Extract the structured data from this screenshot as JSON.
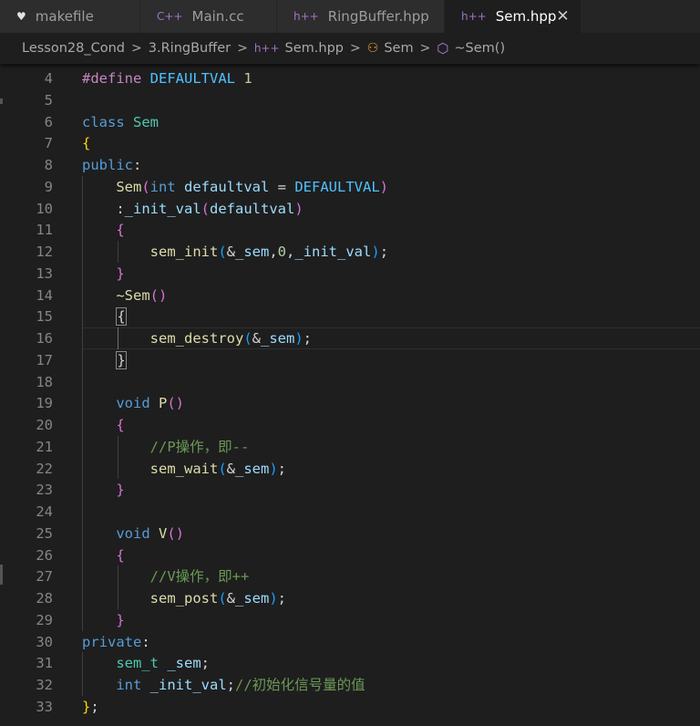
{
  "tabs": [
    {
      "label": "makefile",
      "icon": "makefile-icon",
      "active": false
    },
    {
      "label": "Main.cc",
      "icon": "cpp-file-icon",
      "active": false
    },
    {
      "label": "RingBuffer.hpp",
      "icon": "hpp-file-icon",
      "active": false
    },
    {
      "label": "Sem.hpp",
      "icon": "hpp-file-icon",
      "active": true,
      "close": "✕"
    }
  ],
  "breadcrumb": {
    "items": [
      "Lesson28_Cond",
      "3.RingBuffer",
      "Sem.hpp",
      "Sem",
      "~Sem()"
    ],
    "separator": ">"
  },
  "editor": {
    "active_line": 16,
    "colors": {
      "keyword": "#569cd6",
      "type": "#4ec9b0",
      "function": "#dcdcaa",
      "variable": "#9cdcfe",
      "macro": "#4fc1ff",
      "number": "#b5cea8",
      "comment": "#6a9955",
      "bracket1": "#ffd700",
      "bracket2": "#da70d6"
    },
    "lines": [
      {
        "n": "4",
        "tokens": [
          [
            "pre",
            "#define"
          ],
          [
            "plain",
            " "
          ],
          [
            "macro",
            "DEFAULTVAL"
          ],
          [
            "plain",
            " "
          ],
          [
            "num",
            "1"
          ]
        ]
      },
      {
        "n": "5",
        "tokens": []
      },
      {
        "n": "6",
        "tokens": [
          [
            "kw",
            "class"
          ],
          [
            "plain",
            " "
          ],
          [
            "type",
            "Sem"
          ]
        ]
      },
      {
        "n": "7",
        "tokens": [
          [
            "b1",
            "{"
          ]
        ]
      },
      {
        "n": "8",
        "tokens": [
          [
            "kw",
            "public"
          ],
          [
            "plain",
            ":"
          ]
        ]
      },
      {
        "n": "9",
        "tokens": [
          [
            "plain",
            "    "
          ],
          [
            "fn",
            "Sem"
          ],
          [
            "b2",
            "("
          ],
          [
            "kw",
            "int"
          ],
          [
            "plain",
            " "
          ],
          [
            "var",
            "defaultval"
          ],
          [
            "plain",
            " = "
          ],
          [
            "macro",
            "DEFAULTVAL"
          ],
          [
            "b2",
            ")"
          ]
        ]
      },
      {
        "n": "10",
        "tokens": [
          [
            "plain",
            "    :"
          ],
          [
            "var",
            "_init_val"
          ],
          [
            "b2",
            "("
          ],
          [
            "var",
            "defaultval"
          ],
          [
            "b2",
            ")"
          ]
        ]
      },
      {
        "n": "11",
        "tokens": [
          [
            "plain",
            "    "
          ],
          [
            "b2",
            "{"
          ]
        ]
      },
      {
        "n": "12",
        "tokens": [
          [
            "plain",
            "        "
          ],
          [
            "fn",
            "sem_init"
          ],
          [
            "b3",
            "("
          ],
          [
            "plain",
            "&"
          ],
          [
            "var",
            "_sem"
          ],
          [
            "plain",
            ","
          ],
          [
            "num",
            "0"
          ],
          [
            "plain",
            ","
          ],
          [
            "var",
            "_init_val"
          ],
          [
            "b3",
            ")"
          ],
          [
            "plain",
            ";"
          ]
        ]
      },
      {
        "n": "13",
        "tokens": [
          [
            "plain",
            "    "
          ],
          [
            "b2",
            "}"
          ]
        ]
      },
      {
        "n": "14",
        "tokens": [
          [
            "plain",
            "    "
          ],
          [
            "fn",
            "~Sem"
          ],
          [
            "b2",
            "()"
          ]
        ]
      },
      {
        "n": "15",
        "tokens": [
          [
            "plain",
            "    "
          ],
          [
            "bm2",
            "{"
          ]
        ]
      },
      {
        "n": "16",
        "tokens": [
          [
            "plain",
            "        "
          ],
          [
            "fn",
            "sem_destroy"
          ],
          [
            "b3",
            "("
          ],
          [
            "plain",
            "&"
          ],
          [
            "var",
            "_sem"
          ],
          [
            "b3",
            ")"
          ],
          [
            "plain",
            ";"
          ]
        ]
      },
      {
        "n": "17",
        "tokens": [
          [
            "plain",
            "    "
          ],
          [
            "bm2",
            "}"
          ]
        ]
      },
      {
        "n": "18",
        "tokens": []
      },
      {
        "n": "19",
        "tokens": [
          [
            "plain",
            "    "
          ],
          [
            "kw",
            "void"
          ],
          [
            "plain",
            " "
          ],
          [
            "fn",
            "P"
          ],
          [
            "b2",
            "()"
          ]
        ]
      },
      {
        "n": "20",
        "tokens": [
          [
            "plain",
            "    "
          ],
          [
            "b2",
            "{"
          ]
        ]
      },
      {
        "n": "21",
        "tokens": [
          [
            "plain",
            "        "
          ],
          [
            "cmt",
            "//P操作，即--"
          ]
        ]
      },
      {
        "n": "22",
        "tokens": [
          [
            "plain",
            "        "
          ],
          [
            "fn",
            "sem_wait"
          ],
          [
            "b3",
            "("
          ],
          [
            "plain",
            "&"
          ],
          [
            "var",
            "_sem"
          ],
          [
            "b3",
            ")"
          ],
          [
            "plain",
            ";"
          ]
        ]
      },
      {
        "n": "23",
        "tokens": [
          [
            "plain",
            "    "
          ],
          [
            "b2",
            "}"
          ]
        ]
      },
      {
        "n": "24",
        "tokens": []
      },
      {
        "n": "25",
        "tokens": [
          [
            "plain",
            "    "
          ],
          [
            "kw",
            "void"
          ],
          [
            "plain",
            " "
          ],
          [
            "fn",
            "V"
          ],
          [
            "b2",
            "()"
          ]
        ]
      },
      {
        "n": "26",
        "tokens": [
          [
            "plain",
            "    "
          ],
          [
            "b2",
            "{"
          ]
        ]
      },
      {
        "n": "27",
        "tokens": [
          [
            "plain",
            "        "
          ],
          [
            "cmt",
            "//V操作，即++"
          ]
        ]
      },
      {
        "n": "28",
        "tokens": [
          [
            "plain",
            "        "
          ],
          [
            "fn",
            "sem_post"
          ],
          [
            "b3",
            "("
          ],
          [
            "plain",
            "&"
          ],
          [
            "var",
            "_sem"
          ],
          [
            "b3",
            ")"
          ],
          [
            "plain",
            ";"
          ]
        ]
      },
      {
        "n": "29",
        "tokens": [
          [
            "plain",
            "    "
          ],
          [
            "b2",
            "}"
          ]
        ]
      },
      {
        "n": "30",
        "tokens": [
          [
            "kw",
            "private"
          ],
          [
            "plain",
            ":"
          ]
        ]
      },
      {
        "n": "31",
        "tokens": [
          [
            "plain",
            "    "
          ],
          [
            "type",
            "sem_t"
          ],
          [
            "plain",
            " "
          ],
          [
            "var",
            "_sem"
          ],
          [
            "plain",
            ";"
          ]
        ]
      },
      {
        "n": "32",
        "tokens": [
          [
            "plain",
            "    "
          ],
          [
            "kw",
            "int"
          ],
          [
            "plain",
            " "
          ],
          [
            "var",
            "_init_val"
          ],
          [
            "plain",
            ";"
          ],
          [
            "cmt",
            "//初始化信号量的值"
          ]
        ]
      },
      {
        "n": "33",
        "tokens": [
          [
            "b1",
            "}"
          ],
          [
            "plain",
            ";"
          ]
        ]
      }
    ]
  }
}
